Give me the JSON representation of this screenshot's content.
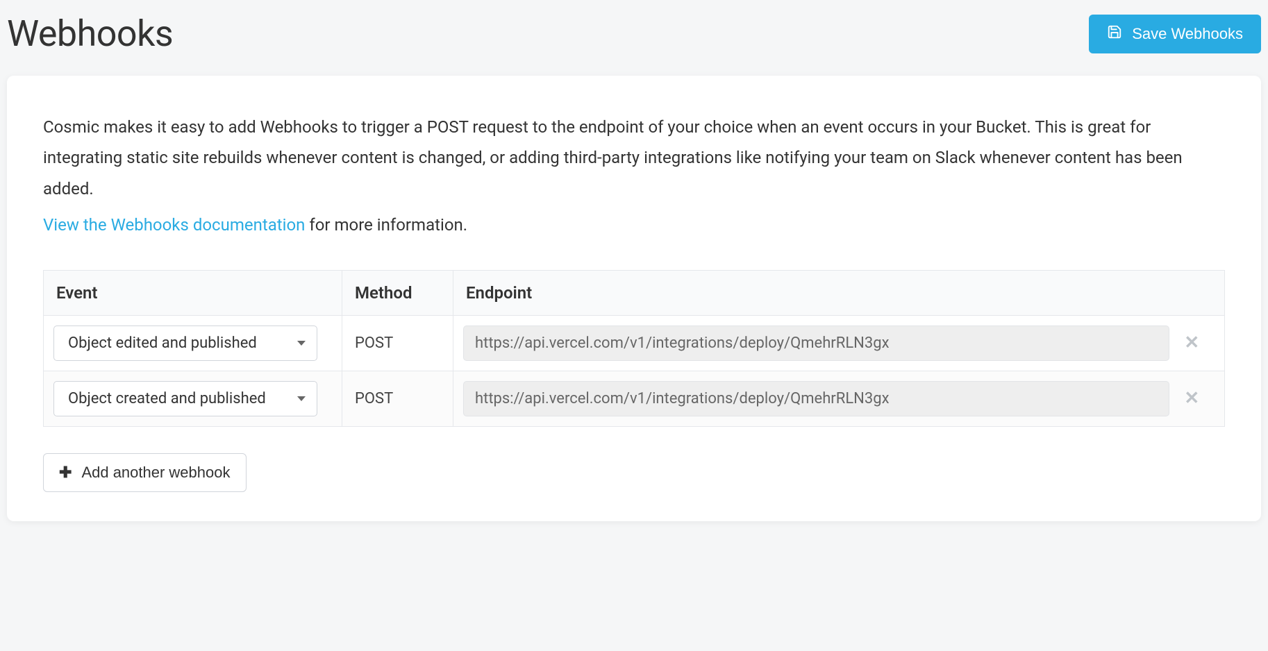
{
  "header": {
    "title": "Webhooks",
    "save_label": "Save Webhooks"
  },
  "intro": {
    "paragraph": "Cosmic makes it easy to add Webhooks to trigger a POST request to the endpoint of your choice when an event occurs in your Bucket. This is great for integrating static site rebuilds whenever content is changed, or adding third-party integrations like notifying your team on Slack whenever content has been added.",
    "doc_link_text": "View the Webhooks documentation",
    "doc_suffix": " for more information."
  },
  "table": {
    "headers": {
      "event": "Event",
      "method": "Method",
      "endpoint": "Endpoint"
    },
    "rows": [
      {
        "event": "Object edited and published",
        "method": "POST",
        "endpoint": "https://api.vercel.com/v1/integrations/deploy/QmehrRLN3gx"
      },
      {
        "event": "Object created and published",
        "method": "POST",
        "endpoint": "https://api.vercel.com/v1/integrations/deploy/QmehrRLN3gx"
      }
    ]
  },
  "add_button_label": "Add another webhook"
}
